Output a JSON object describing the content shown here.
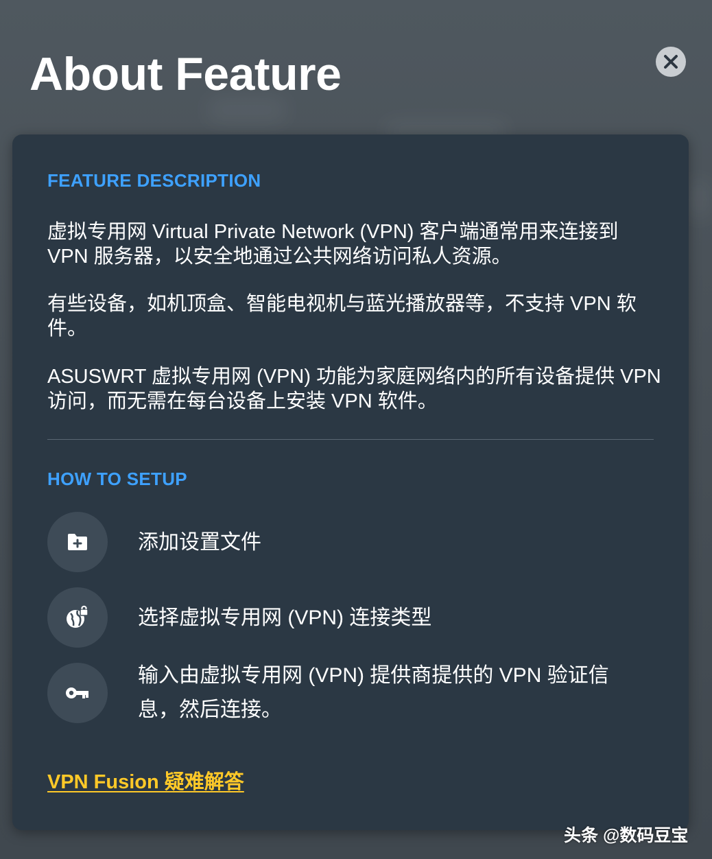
{
  "header": {
    "title": "About Feature",
    "close_icon": "close-icon"
  },
  "description": {
    "heading": "FEATURE DESCRIPTION",
    "paragraphs": [
      "虚拟专用网 Virtual Private Network (VPN) 客户端通常用来连接到 VPN 服务器，以安全地通过公共网络访问私人资源。",
      "有些设备，如机顶盒、智能电视机与蓝光播放器等，不支持 VPN 软件。",
      "ASUSWRT 虚拟专用网 (VPN) 功能为家庭网络内的所有设备提供 VPN 访问，而无需在每台设备上安装 VPN 软件。"
    ]
  },
  "setup": {
    "heading": "HOW TO SETUP",
    "steps": [
      {
        "icon": "folder-add-icon",
        "text": "添加设置文件"
      },
      {
        "icon": "globe-lock-icon",
        "text": "选择虚拟专用网 (VPN) 连接类型"
      },
      {
        "icon": "key-icon",
        "text": "输入由虚拟专用网 (VPN) 提供商提供的 VPN 验证信息，然后连接。"
      }
    ]
  },
  "faq_link": "VPN Fusion 疑难解答",
  "watermark": "头条 @数码豆宝",
  "colors": {
    "accent_blue": "#3ea1ff",
    "link_yellow": "#ffc928",
    "card_bg": "#2b3844",
    "icon_circle": "#3e4b57"
  }
}
